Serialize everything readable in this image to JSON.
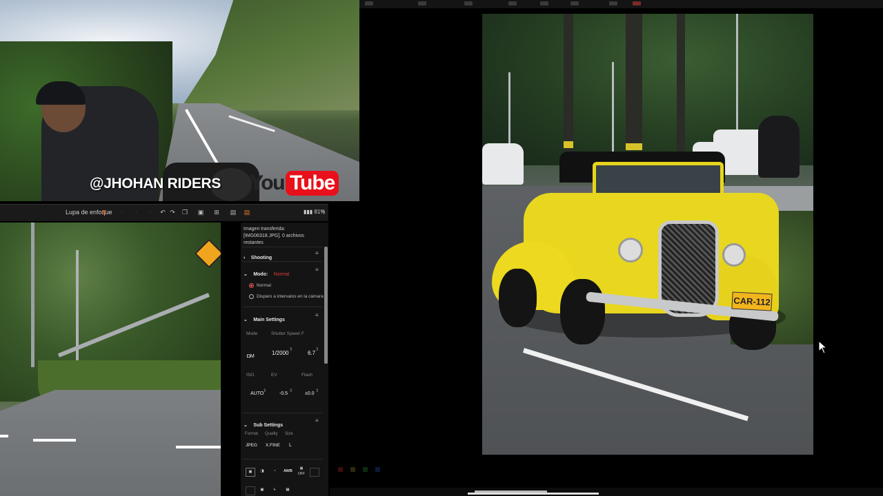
{
  "webcam": {
    "channel_handle": "@JHOHAN RIDERS",
    "logo_you": "You",
    "logo_tube": "Tube"
  },
  "toolbar": {
    "focus_label": "Lupa de enfoque",
    "battery": "81%"
  },
  "panel": {
    "transfer_status": "Imagen transferida: [IMG06318.JPG]. 0 archivos restantes",
    "shooting_header": "Shooting",
    "mode_header": "Modo:",
    "mode_value": "Normal",
    "mode_options": [
      "Normal",
      "Disparo a intervalos en la cámara"
    ],
    "main_header": "Main Settings",
    "main_labels": {
      "mode": "Mode",
      "shutter": "Shutter Speed",
      "f": "F",
      "iso": "ISO",
      "ev": "EV",
      "flash": "Flash"
    },
    "main_values": {
      "mode": "M",
      "shutter": "1/2000",
      "f": "6.7",
      "iso": "AUTO",
      "ev": "-0.5",
      "flash": "±0.0"
    },
    "sub_header": "Sub Settings",
    "sub_labels": {
      "format": "Format",
      "quality": "Quality",
      "size": "Size"
    },
    "sub_values": {
      "format": "JPEG",
      "quality": "X.FINE",
      "size": "L"
    },
    "bottom_buttons": [
      "AWB",
      "OFF"
    ]
  },
  "photo": {
    "plate": "CAR-112"
  },
  "colors": {
    "accent_orange": "#e8742f",
    "mode_red": "#e23b3b",
    "car_yellow": "#e8d71e",
    "youtube_red": "#e8101a"
  }
}
